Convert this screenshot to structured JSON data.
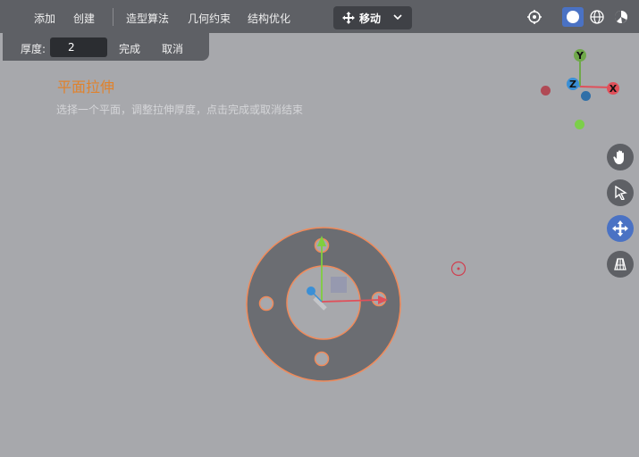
{
  "menu": {
    "add": "添加",
    "create": "创建",
    "modeling_algorithm": "造型算法",
    "geometric_constraint": "几何约束",
    "structure_optimization": "结构优化"
  },
  "mode_select": {
    "value": "移动"
  },
  "extrude_panel": {
    "thickness_label": "厚度:",
    "thickness_value": "2",
    "confirm_label": "完成",
    "cancel_label": "取消"
  },
  "hint": {
    "title": "平面拉伸",
    "text": "选择一个平面，调整拉伸厚度，点击完成或取消结束"
  },
  "gizmo": {
    "x_label": "X",
    "y_label": "Y",
    "z_label": "Z"
  },
  "colors": {
    "accent": "#4a72c4",
    "hint_title": "#e0822c",
    "x_axis": "#e0505a",
    "y_axis": "#6fa84a",
    "z_axis": "#3a8fd6",
    "part_edge": "#f08a5a"
  },
  "icons": {
    "top_right": [
      "target-icon",
      "solid-shading-icon",
      "globe-icon",
      "material-shading-icon"
    ],
    "tools": [
      "hand-icon",
      "select-arrow-icon",
      "move-icon",
      "perspective-icon"
    ]
  }
}
